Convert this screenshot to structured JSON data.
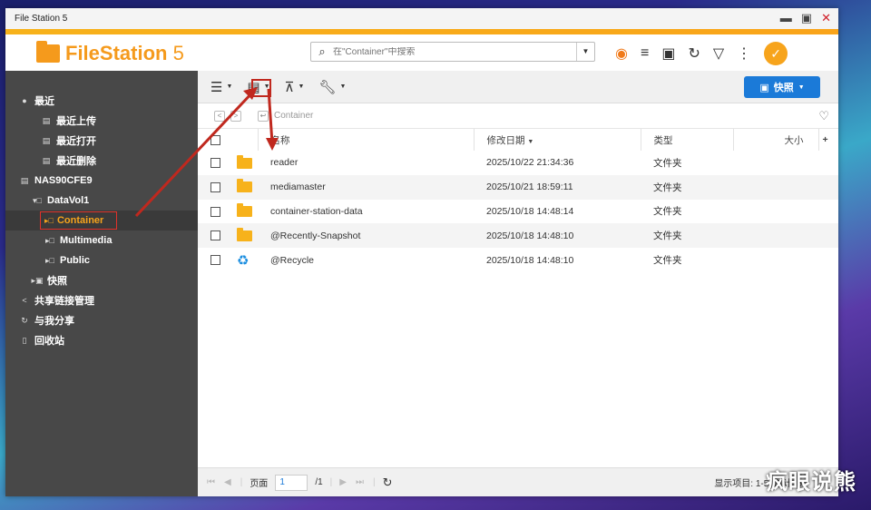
{
  "window": {
    "title": "File Station 5",
    "controls": [
      "▬",
      "▣",
      "✕"
    ]
  },
  "header": {
    "logo_bold": "FileStation",
    "logo_num": " 5",
    "search_placeholder": "在\"Container\"中搜索"
  },
  "sidebar": {
    "recent": "最近",
    "recent_upload": "最近上传",
    "recent_open": "最近打开",
    "recent_delete": "最近删除",
    "nas": "NAS90CFE9",
    "datavol": "DataVol1",
    "container": "Container",
    "multimedia": "Multimedia",
    "public": "Public",
    "snapshot": "快照",
    "share_links": "共享链接管理",
    "shared_with_me": "与我分享",
    "recycle_bin": "回收站"
  },
  "toolbar": {
    "snapshot_button": "快照"
  },
  "path": {
    "crumb": "Container"
  },
  "table": {
    "headers": {
      "name": "名称",
      "modified": "修改日期",
      "type": "类型",
      "size": "大小"
    },
    "rows": [
      {
        "name": "reader",
        "modified": "2025/10/22 21:34:36",
        "type": "文件夹",
        "icon": "folder-icon"
      },
      {
        "name": "mediamaster",
        "modified": "2025/10/21 18:59:11",
        "type": "文件夹",
        "icon": "folder-icon"
      },
      {
        "name": "container-station-data",
        "modified": "2025/10/18 14:48:14",
        "type": "文件夹",
        "icon": "folder-icon"
      },
      {
        "name": "@Recently-Snapshot",
        "modified": "2025/10/18 14:48:10",
        "type": "文件夹",
        "icon": "folder-icon"
      },
      {
        "name": "@Recycle",
        "modified": "2025/10/18 14:48:10",
        "type": "文件夹",
        "icon": "recycle-icon"
      }
    ]
  },
  "footer": {
    "page_label": "页面",
    "page_value": "1",
    "page_total": "/1",
    "status": "显示项目: 1-5, 总计: 5"
  },
  "colors": {
    "accent": "#f7a41c",
    "primary": "#1b7ad8",
    "annotation": "#c0281e"
  },
  "watermark": "疯眼说熊"
}
